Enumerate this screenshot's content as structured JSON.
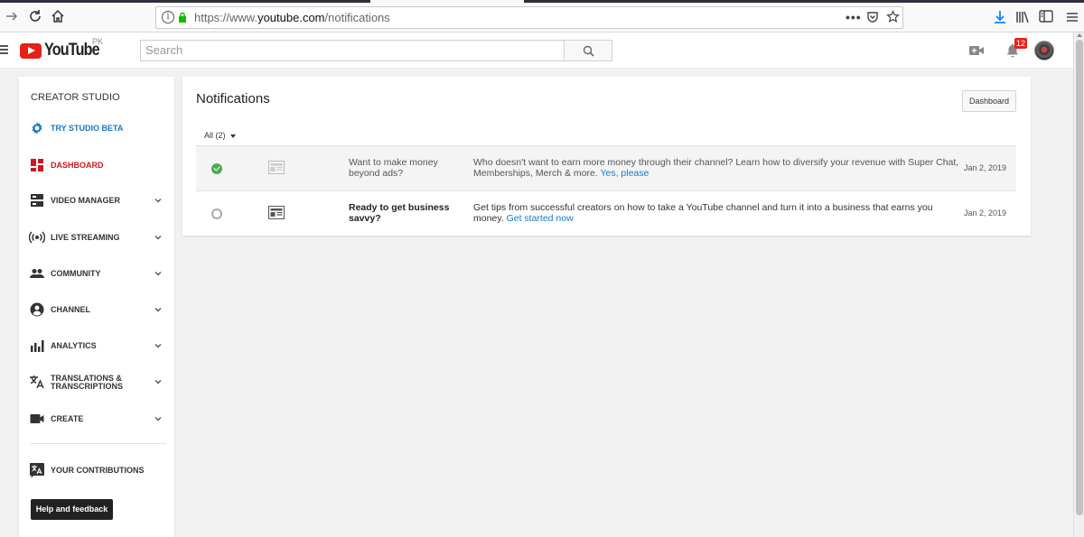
{
  "browser": {
    "url_prefix": "https://www.",
    "url_domain": "youtube.com",
    "url_path": "/notifications",
    "back_icon": "arrow-right-icon",
    "reload_icon": "reload-icon",
    "home_icon": "home-icon"
  },
  "header": {
    "logo_text": "YouTube",
    "country_code": "PK",
    "search_placeholder": "Search",
    "notification_count": "12"
  },
  "sidebar": {
    "title": "CREATOR STUDIO",
    "items": [
      {
        "label": "TRY STUDIO BETA",
        "icon": "gear-icon",
        "color": "#167ac6"
      },
      {
        "label": "DASHBOARD",
        "icon": "dashboard-icon",
        "color": "#cc181e"
      },
      {
        "label": "VIDEO MANAGER",
        "icon": "video-manager-icon"
      },
      {
        "label": "LIVE STREAMING",
        "icon": "live-streaming-icon"
      },
      {
        "label": "COMMUNITY",
        "icon": "community-icon"
      },
      {
        "label": "CHANNEL",
        "icon": "channel-icon"
      },
      {
        "label": "ANALYTICS",
        "icon": "analytics-icon"
      },
      {
        "label_line1": "TRANSLATIONS &",
        "label_line2": "TRANSCRIPTIONS",
        "icon": "translate-icon"
      },
      {
        "label": "CREATE",
        "icon": "create-icon"
      },
      {
        "label": "YOUR CONTRIBUTIONS",
        "icon": "contributions-icon"
      }
    ],
    "help_button": "Help and feedback"
  },
  "main": {
    "title": "Notifications",
    "dashboard_button": "Dashboard",
    "filter_label": "All (2)",
    "notifications": [
      {
        "status": "read",
        "subject": "Want to make money beyond ads?",
        "body": "Who doesn't want to earn more money through their channel? Learn how to diversify your revenue with Super Chat, Memberships, Merch & more.",
        "link": "Yes, please",
        "date": "Jan 2, 2019"
      },
      {
        "status": "unread",
        "subject": "Ready to get business savvy?",
        "body": "Get tips from successful creators on how to take a YouTube channel and turn it into a business that earns you money.",
        "link": "Get started now",
        "date": "Jan 2, 2019"
      }
    ]
  },
  "colors": {
    "accent_blue": "#167ac6",
    "youtube_red": "#e62117",
    "success_green": "#4caf50"
  }
}
